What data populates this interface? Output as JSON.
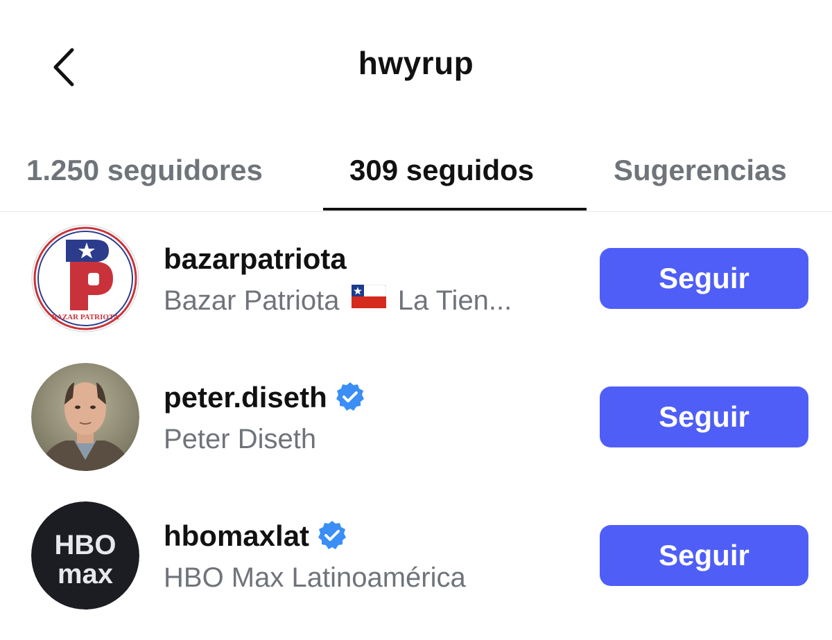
{
  "header": {
    "title": "hwyrup",
    "back_icon": "chevron-left-icon"
  },
  "tabs": [
    {
      "label": "1.250 seguidores",
      "active": false
    },
    {
      "label": "309 seguidos",
      "active": true
    },
    {
      "label": "Sugerencias",
      "active": false
    }
  ],
  "accounts": [
    {
      "username": "bazarpatriota",
      "full_name": "Bazar Patriota",
      "full_name_suffix": "La Tien...",
      "flag_icon": "chile-flag-icon",
      "verified": false,
      "avatar_text": "BAZAR PATRIOTA",
      "avatar_letter": "P",
      "button_label": "Seguir"
    },
    {
      "username": "peter.diseth",
      "full_name": "Peter Diseth",
      "verified": true,
      "avatar": "person-photo",
      "button_label": "Seguir"
    },
    {
      "username": "hbomaxlat",
      "full_name": "HBO Max Latinoamérica",
      "verified": true,
      "avatar": "hbo-max-logo",
      "button_label": "Seguir"
    }
  ],
  "colors": {
    "accent": "#4f5ef7",
    "verified": "#3a8ef6",
    "muted_text": "#6f737a",
    "primary_text": "#111111"
  }
}
